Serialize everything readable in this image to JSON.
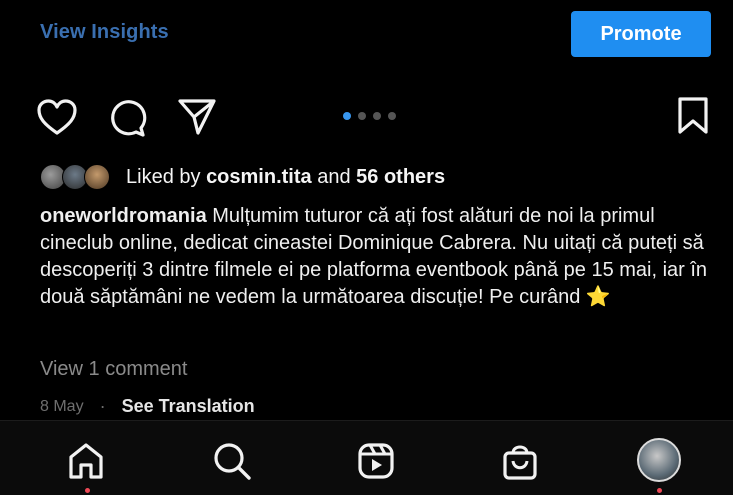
{
  "header": {
    "insights_label": "View Insights",
    "promote_label": "Promote"
  },
  "carousel": {
    "total": 4,
    "active": 1
  },
  "likes": {
    "prefix": "Liked by",
    "user": "cosmin.tita",
    "connector": "and",
    "others": "56 others"
  },
  "caption": {
    "username": "oneworldromania",
    "text": "Mulțumim tuturor că ați fost alături de noi la primul cineclub online, dedicat cineastei Dominique Cabrera. Nu uitați că puteți să descoperiți 3 dintre filmele ei pe platforma eventbook până pe 15 mai, iar în două săptămâni ne vedem la următoarea discuție! Pe curând",
    "emoji": "⭐"
  },
  "comments": {
    "view_label": "View 1 comment"
  },
  "meta": {
    "date": "8 May",
    "translation_label": "See Translation"
  },
  "colors": {
    "accent": "#1f8ef1",
    "link": "#3a6fb0",
    "notification": "#ed4956"
  },
  "icons": [
    "heart-icon",
    "comment-icon",
    "send-icon",
    "bookmark-icon",
    "home-icon",
    "search-icon",
    "reels-icon",
    "shop-icon",
    "profile-avatar"
  ]
}
